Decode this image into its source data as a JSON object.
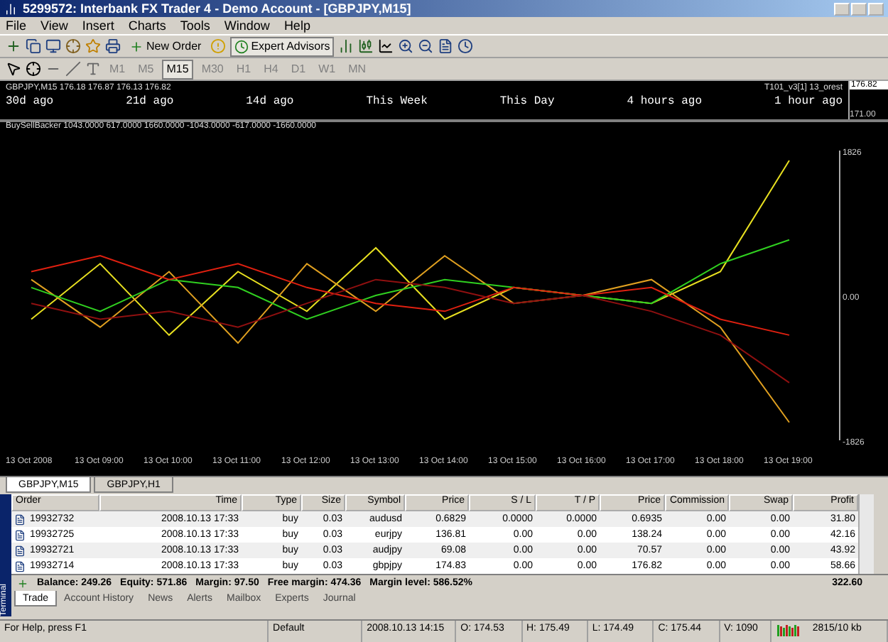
{
  "window": {
    "title": "5299572: Interbank FX Trader 4 - Demo Account - [GBPJPY,M15]"
  },
  "menu": [
    "File",
    "View",
    "Insert",
    "Charts",
    "Tools",
    "Window",
    "Help"
  ],
  "toolbar": {
    "new_order": "New Order",
    "expert_advisors": "Expert Advisors",
    "expert_advisors_on": true
  },
  "timeframes": [
    {
      "label": "M1",
      "selected": false
    },
    {
      "label": "M5",
      "selected": false
    },
    {
      "label": "M15",
      "selected": true
    },
    {
      "label": "M30",
      "selected": false
    },
    {
      "label": "H1",
      "selected": false
    },
    {
      "label": "H4",
      "selected": false
    },
    {
      "label": "D1",
      "selected": false
    },
    {
      "label": "W1",
      "selected": false
    },
    {
      "label": "MN",
      "selected": false
    }
  ],
  "price_pane": {
    "header": "GBPJPY,M15  176.18 176.87 176.13 176.82",
    "indicator_name": "T101_v3[1] 13_orest",
    "current_price": "176.82",
    "low_price": "171.00",
    "periods": [
      "30d ago",
      "21d ago",
      "14d ago",
      "This Week",
      "This Day",
      "4 hours ago",
      "1 hour ago"
    ]
  },
  "indicator": {
    "label": "BuySellBacker 1043.0000 617.0000 1660.0000 -1043.0000 -617.0000 -1660.0000",
    "chart_data": {
      "type": "line",
      "categories": [
        "13 Oct 2008",
        "13 Oct 09:00",
        "13 Oct 10:00",
        "13 Oct 11:00",
        "13 Oct 12:00",
        "13 Oct 13:00",
        "13 Oct 14:00",
        "13 Oct 15:00",
        "13 Oct 16:00",
        "13 Oct 17:00",
        "13 Oct 18:00",
        "13 Oct 19:00"
      ],
      "ylim": [
        -1826,
        1826
      ],
      "yticks": [
        {
          "value": 1826,
          "label": "1826"
        },
        {
          "value": 0,
          "label": "0.00"
        },
        {
          "value": -1826,
          "label": "-1826"
        }
      ],
      "series": [
        {
          "color": "#e8e020",
          "values": [
            -300,
            400,
            -500,
            300,
            -200,
            600,
            -300,
            100,
            0,
            -100,
            300,
            1700
          ]
        },
        {
          "color": "#e0a020",
          "values": [
            200,
            -400,
            300,
            -600,
            400,
            -200,
            500,
            -100,
            0,
            200,
            -400,
            -1600
          ]
        },
        {
          "color": "#30d020",
          "values": [
            100,
            -200,
            200,
            100,
            -300,
            0,
            200,
            100,
            0,
            -100,
            400,
            700
          ]
        },
        {
          "color": "#e02010",
          "values": [
            300,
            500,
            200,
            400,
            100,
            -100,
            -200,
            100,
            0,
            100,
            -300,
            -500
          ]
        },
        {
          "color": "#901010",
          "values": [
            -100,
            -300,
            -200,
            -400,
            -100,
            200,
            100,
            -100,
            0,
            -200,
            -500,
            -1100
          ]
        }
      ]
    }
  },
  "chart_tabs": [
    {
      "label": "GBPJPY,M15",
      "selected": true
    },
    {
      "label": "GBPJPY,H1",
      "selected": false
    }
  ],
  "table": {
    "columns": [
      "Order",
      "Time",
      "Type",
      "Size",
      "Symbol",
      "Price",
      "S / L",
      "T / P",
      "Price",
      "Commission",
      "Swap",
      "Profit"
    ],
    "rows": [
      [
        "19932732",
        "2008.10.13 17:33",
        "buy",
        "0.03",
        "audusd",
        "0.6829",
        "0.0000",
        "0.0000",
        "0.6935",
        "0.00",
        "0.00",
        "31.80"
      ],
      [
        "19932725",
        "2008.10.13 17:33",
        "buy",
        "0.03",
        "eurjpy",
        "136.81",
        "0.00",
        "0.00",
        "138.24",
        "0.00",
        "0.00",
        "42.16"
      ],
      [
        "19932721",
        "2008.10.13 17:33",
        "buy",
        "0.03",
        "audjpy",
        "69.08",
        "0.00",
        "0.00",
        "70.57",
        "0.00",
        "0.00",
        "43.92"
      ],
      [
        "19932714",
        "2008.10.13 17:33",
        "buy",
        "0.03",
        "gbpjpy",
        "174.83",
        "0.00",
        "0.00",
        "176.82",
        "0.00",
        "0.00",
        "58.66"
      ]
    ],
    "summary": [
      "Balance: 249.26",
      "Equity: 571.86",
      "Margin: 97.50",
      "Free margin: 474.36",
      "Margin level: 586.52%"
    ],
    "total": "322.60"
  },
  "terminal_label": "Terminal",
  "terminal_tabs": [
    {
      "label": "Trade",
      "selected": true
    },
    {
      "label": "Account History",
      "selected": false
    },
    {
      "label": "News",
      "selected": false
    },
    {
      "label": "Alerts",
      "selected": false
    },
    {
      "label": "Mailbox",
      "selected": false
    },
    {
      "label": "Experts",
      "selected": false
    },
    {
      "label": "Journal",
      "selected": false
    }
  ],
  "status_bar": {
    "help": "For Help, press F1",
    "profile": "Default",
    "time": "2008.10.13 14:15",
    "open": "O: 174.53",
    "high": "H: 175.49",
    "low": "L: 174.49",
    "close": "C: 175.44",
    "volume": "V: 1090",
    "traffic": "2815/10 kb"
  }
}
